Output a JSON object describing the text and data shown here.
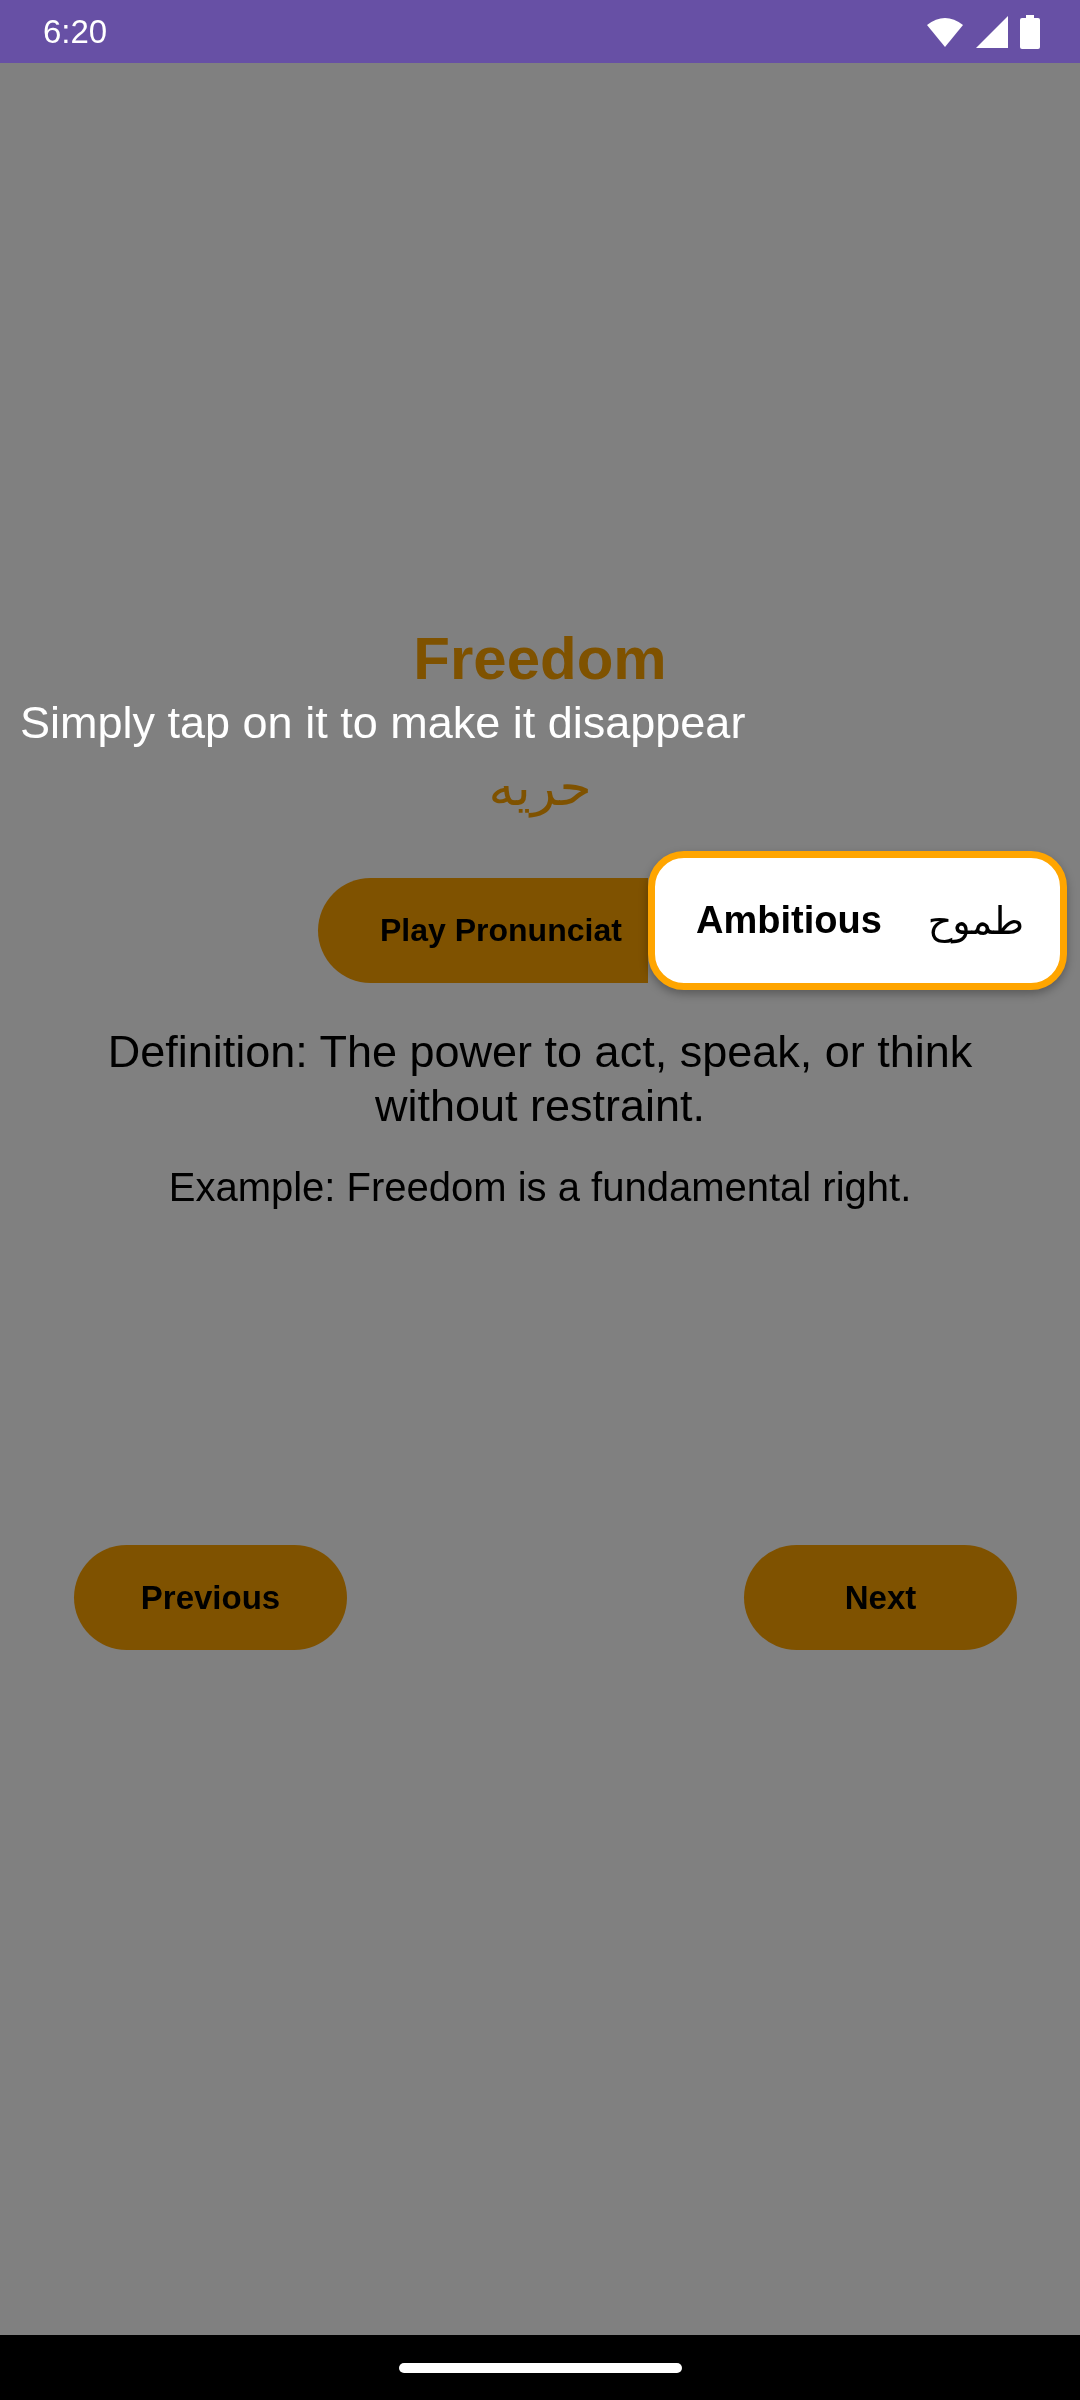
{
  "status_bar": {
    "time": "6:20"
  },
  "word": {
    "english": "Freedom",
    "arabic": "حريه"
  },
  "play_button": {
    "label": "Play Pronunciat"
  },
  "definition": "Definition: The power to act, speak, or think without restraint.",
  "example": "Example: Freedom is a fundamental right.",
  "nav_buttons": [
    {
      "label": "Previous"
    },
    {
      "label": "Next"
    }
  ],
  "hint": "Simply tap on it to make it disappear",
  "popup": {
    "english": "Ambitious",
    "arabic": "طموح"
  }
}
